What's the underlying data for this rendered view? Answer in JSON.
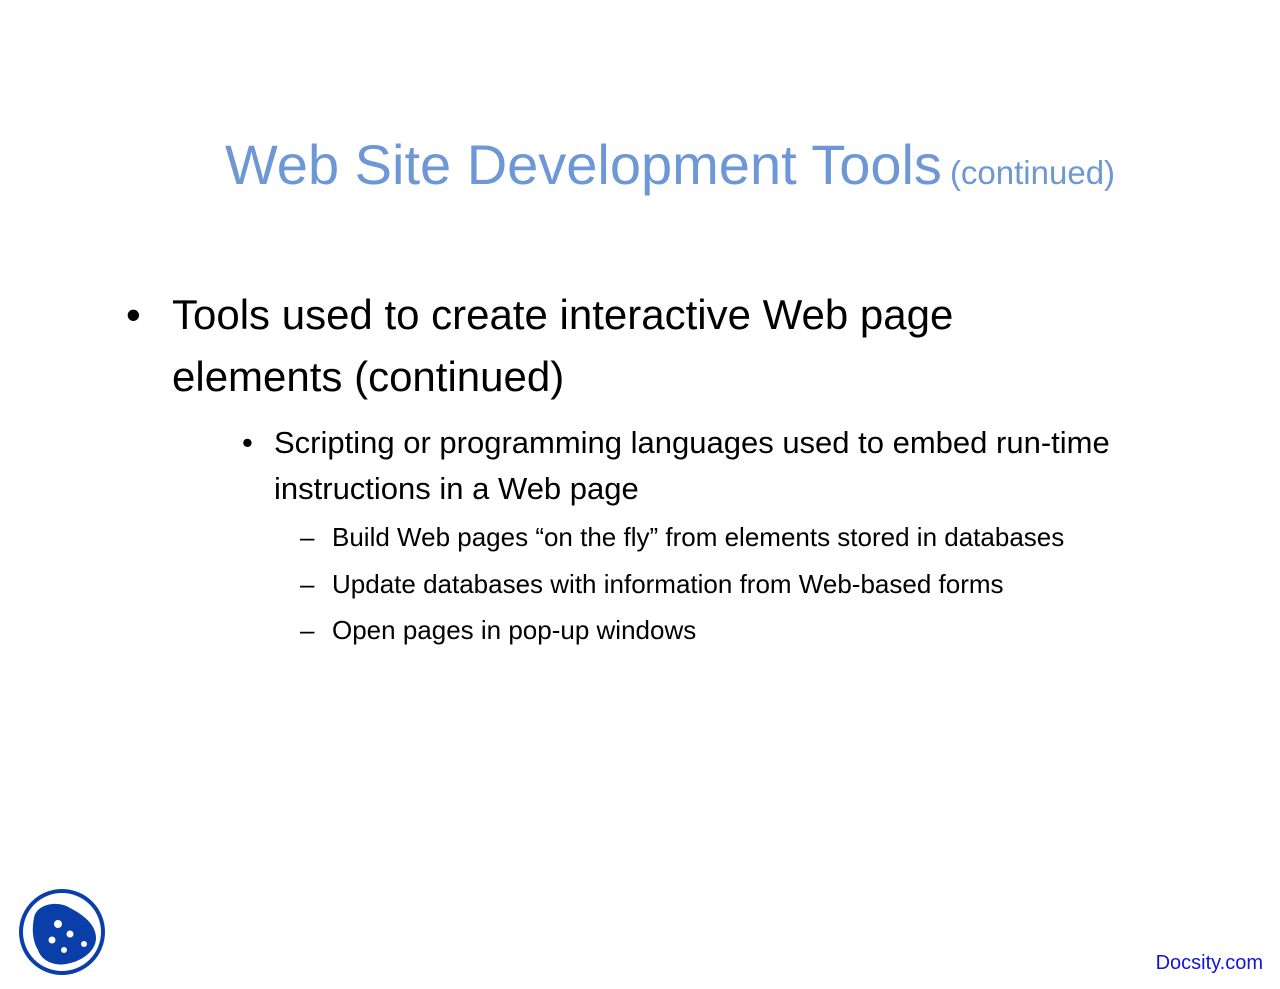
{
  "slide": {
    "title": "Web Site Development Tools",
    "title_suffix": "(continued)",
    "bullet_marker": "•",
    "dash_marker": "–",
    "level1": {
      "text": "Tools used to create interactive Web page elements (continued)"
    },
    "level2": {
      "text": "Scripting or programming languages used to embed run-time instructions in a Web page"
    },
    "level3": [
      "Build Web pages “on the fly” from elements stored in databases",
      "Update databases with information from Web-based forms",
      "Open pages in pop-up windows"
    ]
  },
  "footer": {
    "brand": "Docsity.com",
    "logo_icon": "docsity-logo-icon"
  },
  "colors": {
    "title": "#6d97d5",
    "body_text": "#000000",
    "brand": "#1414d8",
    "logo": "#0a3ea8"
  }
}
